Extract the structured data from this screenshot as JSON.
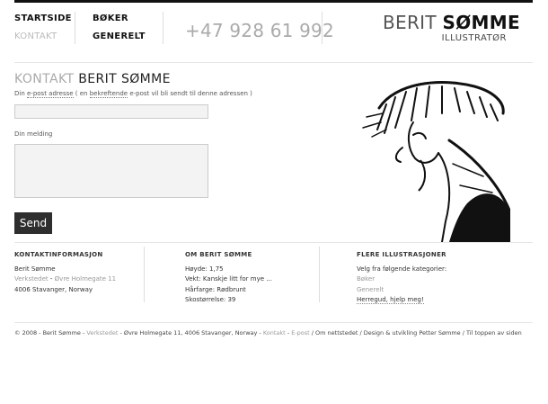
{
  "nav": {
    "startside": "STARTSIDE",
    "kontakt": "KONTAKT",
    "boker": "BØKER",
    "generelt": "GENERELT"
  },
  "header": {
    "phone": "+47 928 61 992",
    "logo_first": "BERIT ",
    "logo_last": "SØMME",
    "logo_sub": "ILLUSTRATØR"
  },
  "contact": {
    "title_prefix": "KONTAKT ",
    "title_name": "BERIT SØMME",
    "email_label_start": "Din ",
    "email_label_link": "e-post adresse",
    "email_label_mid": "  ( en ",
    "email_label_link2": "bekreftende",
    "email_label_end": " e-post vil bli sendt til denne adressen )",
    "email_value": "",
    "message_label": "Din melding",
    "message_value": "",
    "send_label": "Send"
  },
  "info": {
    "heading": "KONTAKTINFORMASJON",
    "name": "Berit Sømme",
    "workplace_link": "Verkstedet",
    "address_sep": " - ",
    "address_link": "Øvre Holmegate 11",
    "city": "4006 Stavanger, Norway"
  },
  "about": {
    "heading": "OM BERIT SØMME",
    "height": "Høyde: 1,75",
    "weight": "Vekt: Kanskje litt for mye ...",
    "hair": "Hårfarge: Rødbrunt",
    "shoe": "Skostørrelse: 39"
  },
  "more": {
    "heading": "FLERE ILLUSTRASJONER",
    "intro": "Velg fra følgende kategorier:",
    "cat1": "Bøker",
    "cat2": "Generelt",
    "cat3": "Herregud, hjelp meg!"
  },
  "footer": {
    "copy": "© 2008 - Berit Sømme - ",
    "verkstedet": "Verkstedet",
    "addr": " - Øvre Holmegate 11, 4006 Stavanger, Norway - ",
    "kontakt": "Kontakt",
    "dash": " - ",
    "epost": "E-post",
    "slash1": " / ",
    "om": "Om nettstedet",
    "slash2": " / ",
    "design": "Design & utvikling Petter Sømme",
    "slash3": " / ",
    "top": "Til toppen av siden"
  }
}
